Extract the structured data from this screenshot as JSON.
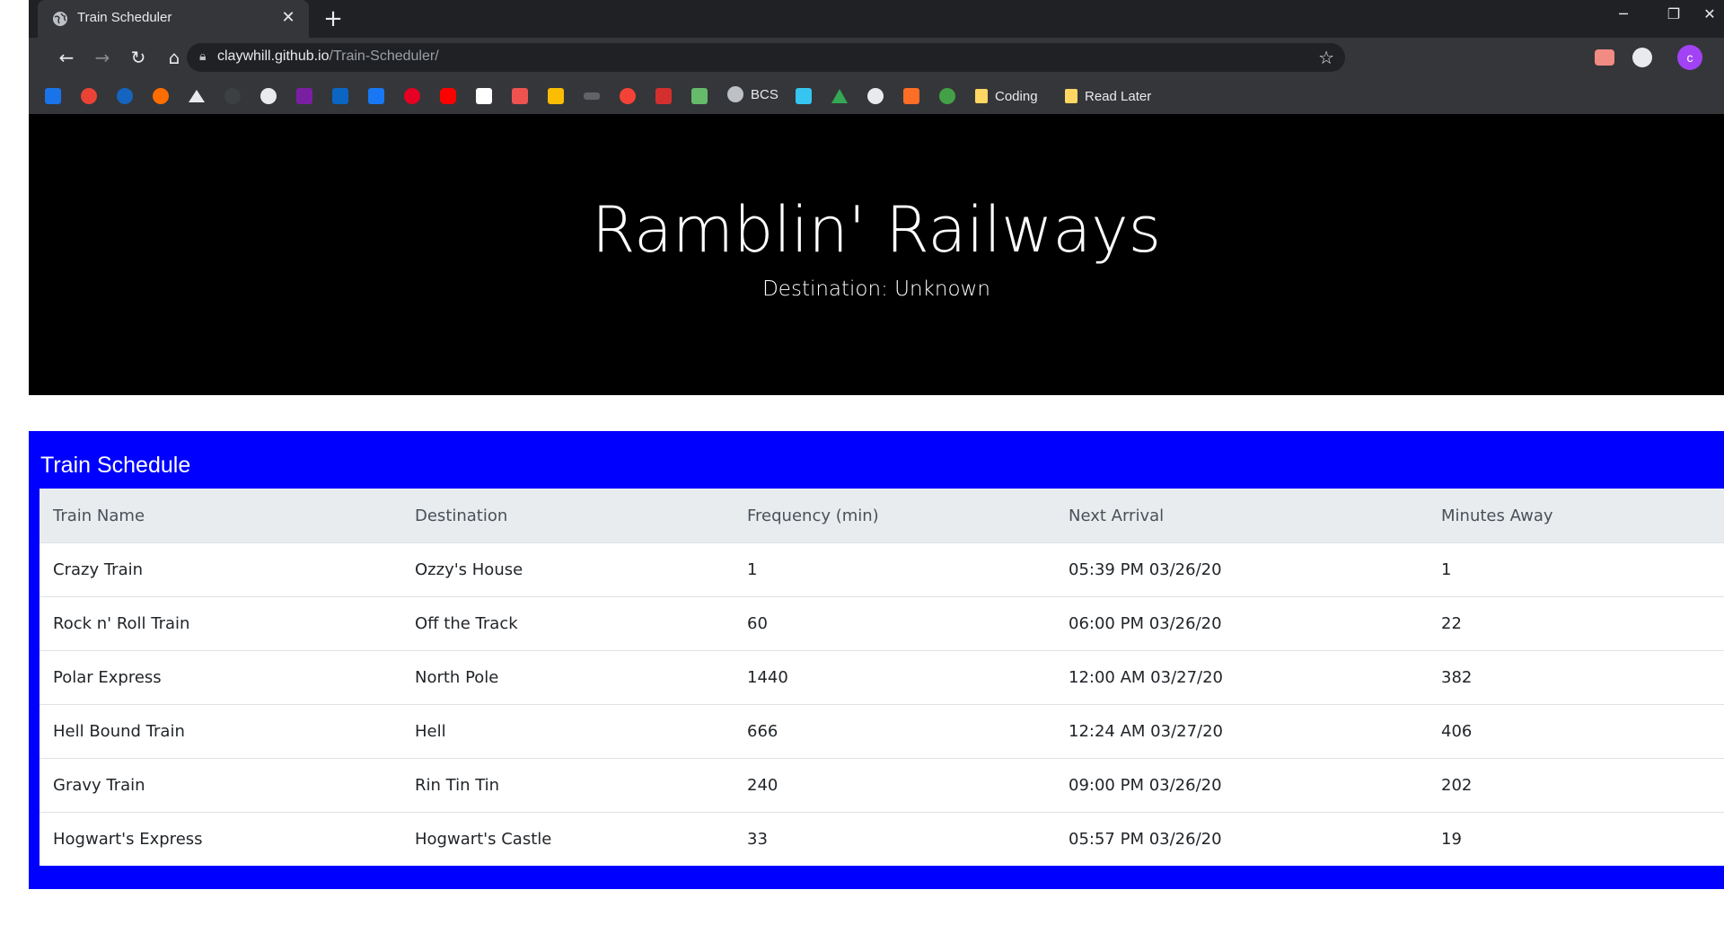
{
  "browser": {
    "tab_title": "Train Scheduler",
    "tab_close": "✕",
    "new_tab": "+",
    "url_host": "claywhill.github.io",
    "url_path": "/Train-Scheduler/",
    "avatar_letter": "c",
    "window_controls": {
      "minimize": "─",
      "restore": "❐",
      "close": "✕"
    },
    "bookmarks": {
      "bcs_label": "BCS",
      "folders": [
        "Coding",
        "Read Later"
      ]
    }
  },
  "hero": {
    "title": "Ramblin' Railways",
    "subtitle": "Destination: Unknown"
  },
  "schedule": {
    "header": "Train Schedule",
    "columns": [
      "Train Name",
      "Destination",
      "Frequency (min)",
      "Next Arrival",
      "Minutes Away"
    ],
    "rows": [
      [
        "Crazy Train",
        "Ozzy's House",
        "1",
        "05:39 PM 03/26/20",
        "1"
      ],
      [
        "Rock n' Roll Train",
        "Off the Track",
        "60",
        "06:00 PM 03/26/20",
        "22"
      ],
      [
        "Polar Express",
        "North Pole",
        "1440",
        "12:00 AM 03/27/20",
        "382"
      ],
      [
        "Hell Bound Train",
        "Hell",
        "666",
        "12:24 AM 03/27/20",
        "406"
      ],
      [
        "Gravy Train",
        "Rin Tin Tin",
        "240",
        "09:00 PM 03/26/20",
        "202"
      ],
      [
        "Hogwart's Express",
        "Hogwart's Castle",
        "33",
        "05:57 PM 03/26/20",
        "19"
      ]
    ]
  },
  "colors": {
    "card_blue": "#0000ff",
    "jumbotron": "#000000",
    "table_header": "#e9ecef"
  }
}
